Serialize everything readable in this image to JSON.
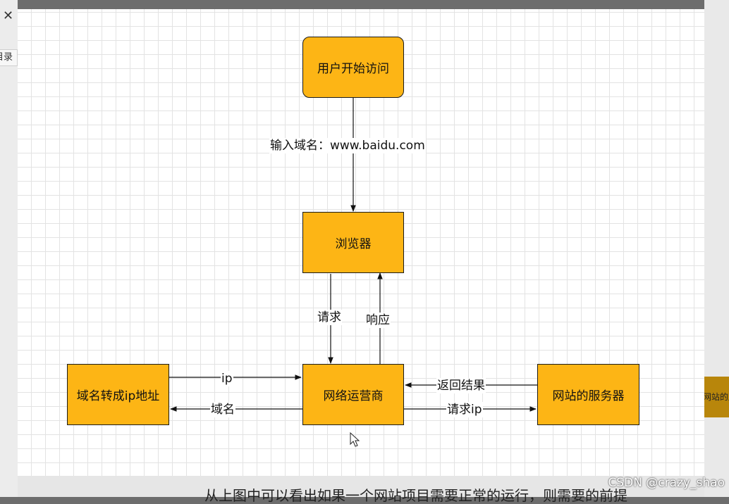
{
  "sidebar": {
    "catalog_label": "目录"
  },
  "right_panel": {
    "box_label": "网站的服务器"
  },
  "bottom": {
    "text": "从上图中可以看出如果一个网站项目需要正常的运行，则需要的前提"
  },
  "watermark": "CSDN @crazy_shao",
  "diagram": {
    "nodes": {
      "user": "用户开始访问",
      "browser": "浏览器",
      "dns": "域名转成ip地址",
      "isp": "网络运营商",
      "server": "网站的服务器"
    },
    "edges": {
      "input_domain": "输入域名：www.baidu.com",
      "request": "请求",
      "response": "响应",
      "ip": "ip",
      "domain": "域名",
      "return_result": "返回结果",
      "request_ip": "请求ip"
    }
  }
}
